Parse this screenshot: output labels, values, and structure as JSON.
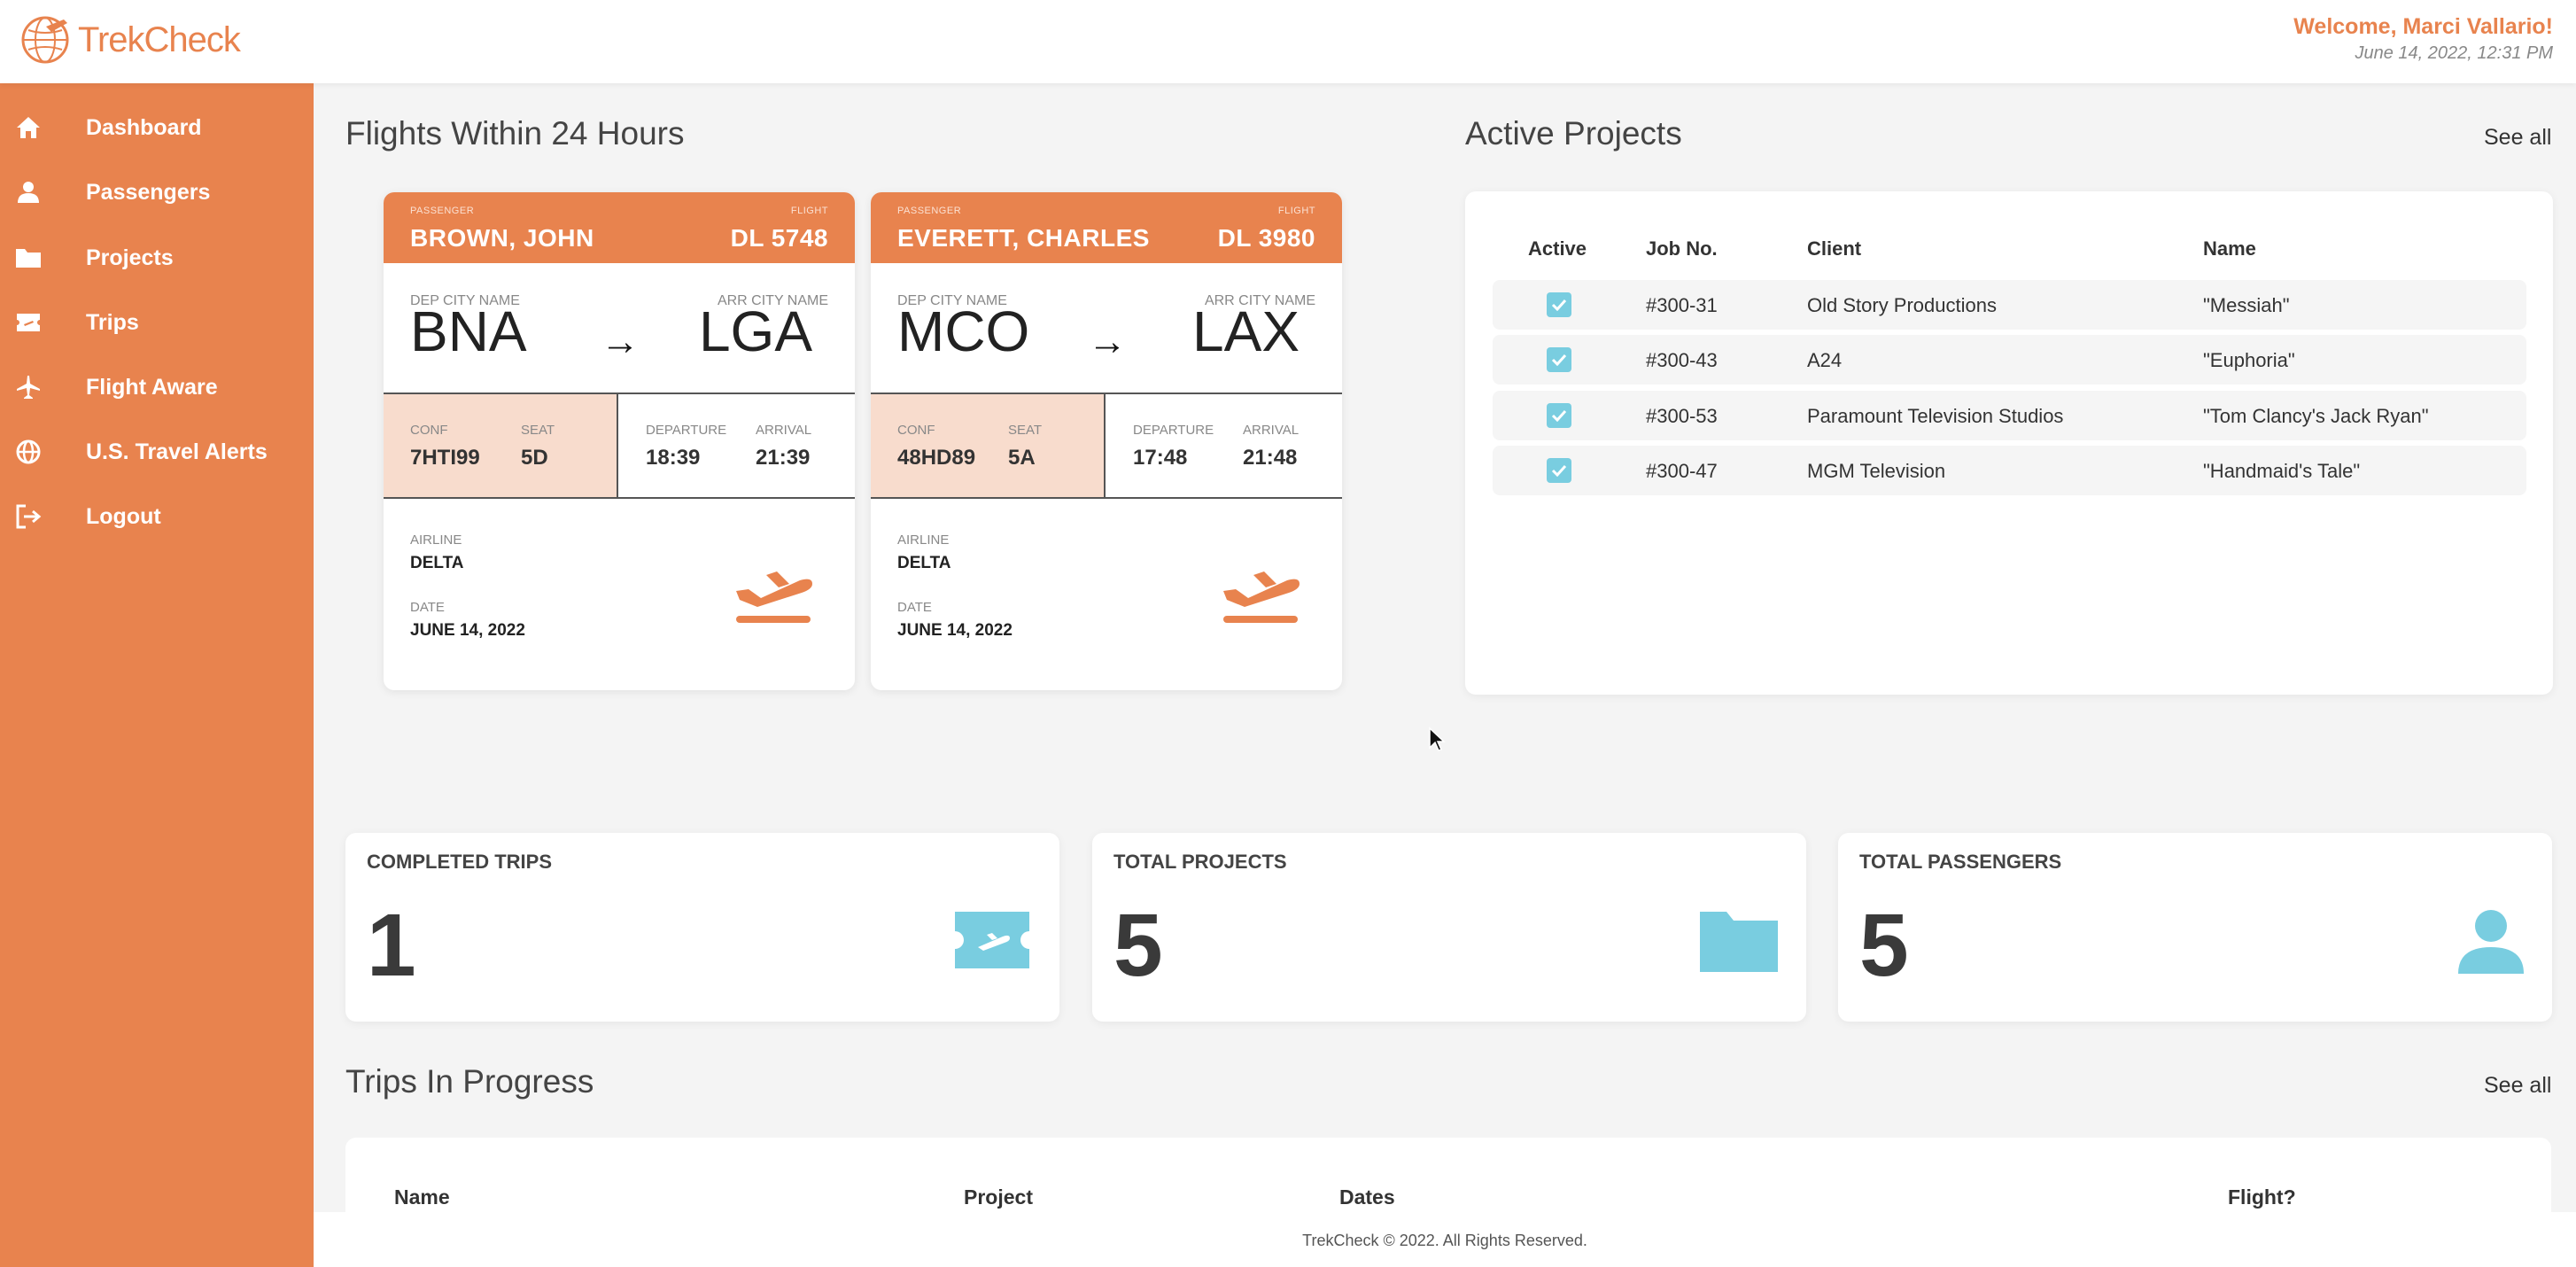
{
  "app": {
    "name": "TrekCheck",
    "welcome": "Welcome, Marci Vallario!",
    "datetime": "June 14, 2022, 12:31 PM",
    "accent_color": "#e8834e",
    "stat_icon_color": "#79cde0"
  },
  "sidebar": {
    "items": [
      {
        "label": "Dashboard",
        "icon": "home-icon"
      },
      {
        "label": "Passengers",
        "icon": "person-icon"
      },
      {
        "label": "Projects",
        "icon": "folder-icon"
      },
      {
        "label": "Trips",
        "icon": "ticket-icon"
      },
      {
        "label": "Flight Aware",
        "icon": "airplane-icon"
      },
      {
        "label": "U.S. Travel Alerts",
        "icon": "globe-icon"
      },
      {
        "label": "Logout",
        "icon": "logout-icon"
      }
    ]
  },
  "flights": {
    "title": "Flights Within 24 Hours",
    "cards": [
      {
        "passenger_label": "PASSENGER",
        "passenger": "BROWN, JOHN",
        "flight_label": "FLIGHT",
        "flight": "DL 5748",
        "dep_label": "DEP CITY NAME",
        "dep": "BNA",
        "arr_label": "ARR CITY NAME",
        "arr": "LGA",
        "arrow": "→",
        "conf_label": "CONF",
        "conf": "7HTI99",
        "seat_label": "SEAT",
        "seat": "5D",
        "departure_label": "DEPARTURE",
        "departure": "18:39",
        "arrival_label": "ARRIVAL",
        "arrival": "21:39",
        "airline_label": "AIRLINE",
        "airline": "DELTA",
        "date_label": "DATE",
        "date": "JUNE 14, 2022"
      },
      {
        "passenger_label": "PASSENGER",
        "passenger": "EVERETT, CHARLES",
        "flight_label": "FLIGHT",
        "flight": "DL 3980",
        "dep_label": "DEP CITY NAME",
        "dep": "MCO",
        "arr_label": "ARR CITY NAME",
        "arr": "LAX",
        "arrow": "→",
        "conf_label": "CONF",
        "conf": "48HD89",
        "seat_label": "SEAT",
        "seat": "5A",
        "departure_label": "DEPARTURE",
        "departure": "17:48",
        "arrival_label": "ARRIVAL",
        "arrival": "21:48",
        "airline_label": "AIRLINE",
        "airline": "DELTA",
        "date_label": "DATE",
        "date": "JUNE 14, 2022"
      }
    ]
  },
  "projects": {
    "title": "Active Projects",
    "see_all": "See all",
    "columns": [
      "Active",
      "Job No.",
      "Client",
      "Name"
    ],
    "rows": [
      {
        "active": true,
        "job": "#300-31",
        "client": "Old Story Productions",
        "name": "\"Messiah\""
      },
      {
        "active": true,
        "job": "#300-43",
        "client": "A24",
        "name": "\"Euphoria\""
      },
      {
        "active": true,
        "job": "#300-53",
        "client": "Paramount Television Studios",
        "name": "\"Tom Clancy's Jack Ryan\""
      },
      {
        "active": true,
        "job": "#300-47",
        "client": "MGM Television",
        "name": "\"Handmaid's Tale\""
      }
    ]
  },
  "stats": [
    {
      "label": "COMPLETED TRIPS",
      "value": "1",
      "icon": "ticket-icon"
    },
    {
      "label": "TOTAL PROJECTS",
      "value": "5",
      "icon": "folder-icon"
    },
    {
      "label": "TOTAL PASSENGERS",
      "value": "5",
      "icon": "person-icon"
    }
  ],
  "trips": {
    "title": "Trips In Progress",
    "see_all": "See all",
    "columns": [
      "Name",
      "Project",
      "Dates",
      "Flight?"
    ]
  },
  "footer": "TrekCheck © 2022. All Rights Reserved."
}
